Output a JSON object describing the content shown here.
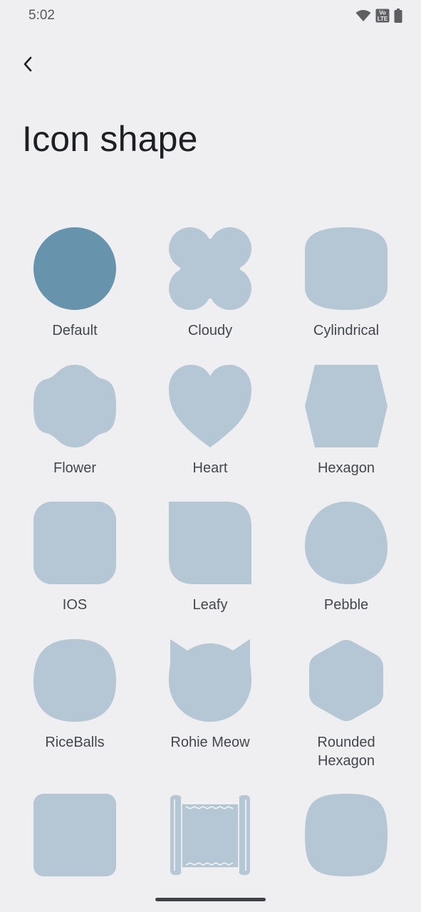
{
  "status_bar": {
    "time": "5:02",
    "icons": [
      "wifi-icon",
      "volte-icon",
      "battery-icon"
    ],
    "volte_text_top": "Vo",
    "volte_text_bottom": "LTE"
  },
  "header": {
    "back_icon": "chevron-left-icon",
    "title": "Icon shape"
  },
  "colors": {
    "selected": "#6893ad",
    "unselected": "#b5c6d4",
    "background": "#efeff2"
  },
  "shapes": [
    {
      "id": "default",
      "label": "Default",
      "selected": true
    },
    {
      "id": "cloudy",
      "label": "Cloudy",
      "selected": false
    },
    {
      "id": "cylindrical",
      "label": "Cylindrical",
      "selected": false
    },
    {
      "id": "flower",
      "label": "Flower",
      "selected": false
    },
    {
      "id": "heart",
      "label": "Heart",
      "selected": false
    },
    {
      "id": "hexagon",
      "label": "Hexagon",
      "selected": false
    },
    {
      "id": "ios",
      "label": "IOS",
      "selected": false
    },
    {
      "id": "leafy",
      "label": "Leafy",
      "selected": false
    },
    {
      "id": "pebble",
      "label": "Pebble",
      "selected": false
    },
    {
      "id": "riceballs",
      "label": "RiceBalls",
      "selected": false
    },
    {
      "id": "rohie-meow",
      "label": "Rohie Meow",
      "selected": false
    },
    {
      "id": "rounded-hexagon",
      "label": "Rounded Hexagon",
      "selected": false
    },
    {
      "id": "square",
      "label": "",
      "selected": false
    },
    {
      "id": "scroll",
      "label": "",
      "selected": false
    },
    {
      "id": "squircle",
      "label": "",
      "selected": false
    }
  ]
}
